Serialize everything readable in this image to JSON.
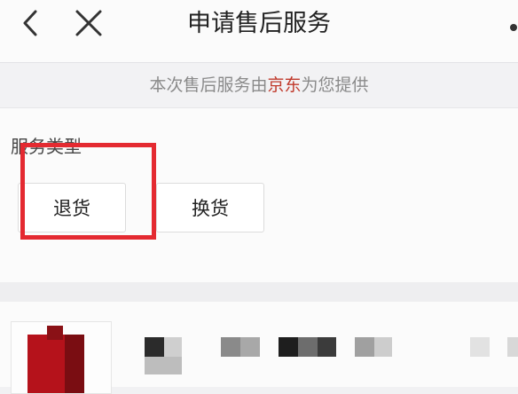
{
  "header": {
    "title": "申请售后服务",
    "back_icon": "chevron-left-icon",
    "close_icon": "close-icon",
    "more_icon": "more-dots-icon"
  },
  "notice": {
    "prefix": "本次售后服务由",
    "brand": "京东",
    "suffix": "为您提供",
    "brand_color": "#c0392b"
  },
  "service_type": {
    "label": "服务类型",
    "options": [
      "退货",
      "换货"
    ],
    "highlight_color": "#e42a31"
  },
  "product": {
    "image": "product-thumbnail",
    "title_blurred": true
  }
}
